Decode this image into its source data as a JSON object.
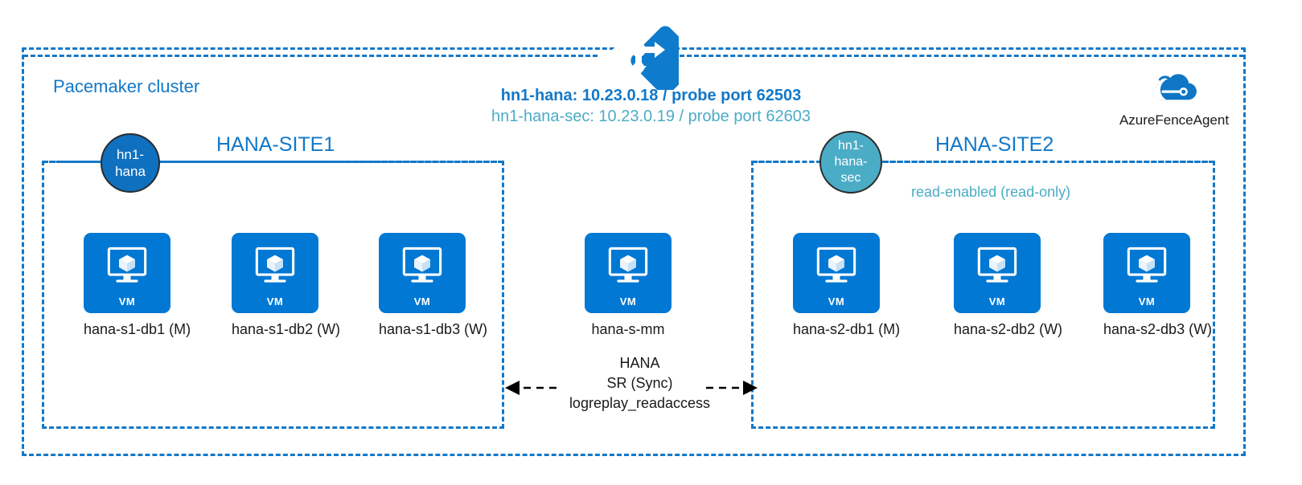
{
  "diagram": {
    "cluster_label": "Pacemaker cluster",
    "load_balancer": {
      "icon": "load-balancer-icon",
      "primary_vip": "hn1-hana:  10.23.0.18 / probe port 62503",
      "secondary_vip": "hn1-hana-sec: 10.23.0.19 / probe port 62603"
    },
    "fence_agent": {
      "icon": "azure-cloud-icon",
      "label": "AzureFenceAgent"
    },
    "sites": [
      {
        "title": "HANA-SITE1",
        "badge": "hn1-hana",
        "badge_lines": [
          "hn1-",
          "hana"
        ],
        "note": "",
        "vms": [
          {
            "label": "hana-s1-db1 (M)",
            "tile_text": "VM"
          },
          {
            "label": "hana-s1-db2 (W)",
            "tile_text": "VM"
          },
          {
            "label": "hana-s1-db3 (W)",
            "tile_text": "VM"
          }
        ]
      },
      {
        "title": "HANA-SITE2",
        "badge": "hn1-hana-sec",
        "badge_lines": [
          "hn1-",
          "hana-",
          "sec"
        ],
        "note": "read-enabled (read-only)",
        "vms": [
          {
            "label": "hana-s2-db1 (M)",
            "tile_text": "VM"
          },
          {
            "label": "hana-s2-db2 (W)",
            "tile_text": "VM"
          },
          {
            "label": "hana-s2-db3 (W)",
            "tile_text": "VM"
          }
        ]
      }
    ],
    "majority_maker": {
      "label": "hana-s-mm",
      "tile_text": "VM"
    },
    "replication": {
      "line1": "HANA",
      "line2": "SR (Sync)",
      "line3": "logreplay_readaccess"
    },
    "colors": {
      "azure_blue": "#0078D4",
      "dash_blue": "#1278c8",
      "teal": "#4BACC6",
      "node_blue": "#1070c0",
      "text_dark": "#1a1a1a"
    }
  }
}
